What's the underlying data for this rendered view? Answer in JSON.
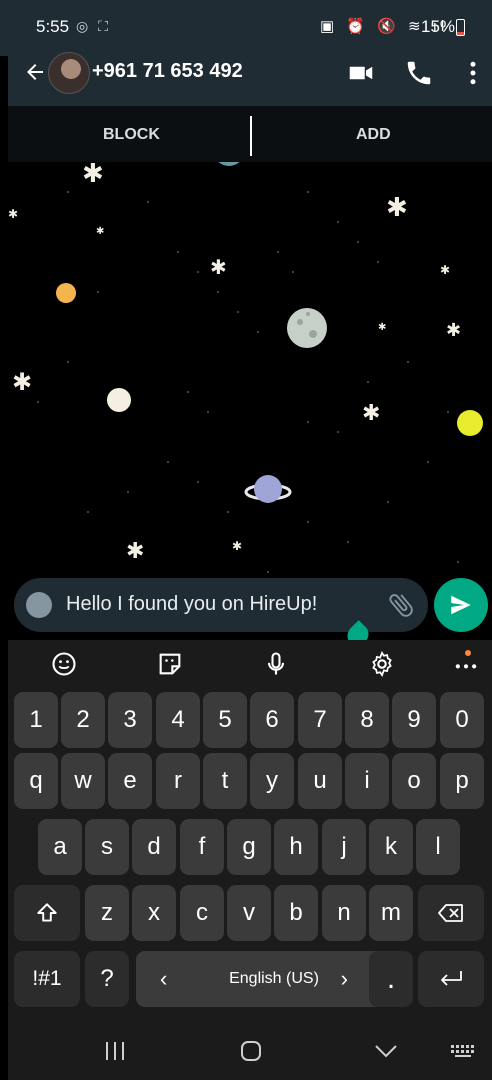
{
  "status_bar": {
    "time": "5:55",
    "battery": "15%"
  },
  "header": {
    "contact_name": "+961 71 653 492"
  },
  "actions": {
    "block_label": "BLOCK",
    "add_label": "ADD"
  },
  "composer": {
    "message_text": "Hello I found you on HireUp!"
  },
  "keyboard": {
    "number_row": [
      "1",
      "2",
      "3",
      "4",
      "5",
      "6",
      "7",
      "8",
      "9",
      "0"
    ],
    "row1": [
      "q",
      "w",
      "e",
      "r",
      "t",
      "y",
      "u",
      "i",
      "o",
      "p"
    ],
    "row2": [
      "a",
      "s",
      "d",
      "f",
      "g",
      "h",
      "j",
      "k",
      "l"
    ],
    "row3": [
      "z",
      "x",
      "c",
      "v",
      "b",
      "n",
      "m"
    ],
    "symbols_label": "!#1",
    "question_label": "?",
    "space_label": "English (US)",
    "space_left": "‹",
    "space_right": "›",
    "period_label": "."
  },
  "colors": {
    "accent": "#00a884",
    "header_bg": "#1f2c33",
    "key_bg": "#3b3b3b",
    "keyboard_bg": "#1b1b1b"
  },
  "icons": [
    "back-arrow-icon",
    "video-call-icon",
    "voice-call-icon",
    "more-vert-icon",
    "emoji-icon",
    "attach-icon",
    "send-icon",
    "sticker-icon",
    "mic-icon",
    "settings-icon",
    "shift-icon",
    "backspace-icon",
    "enter-icon"
  ]
}
